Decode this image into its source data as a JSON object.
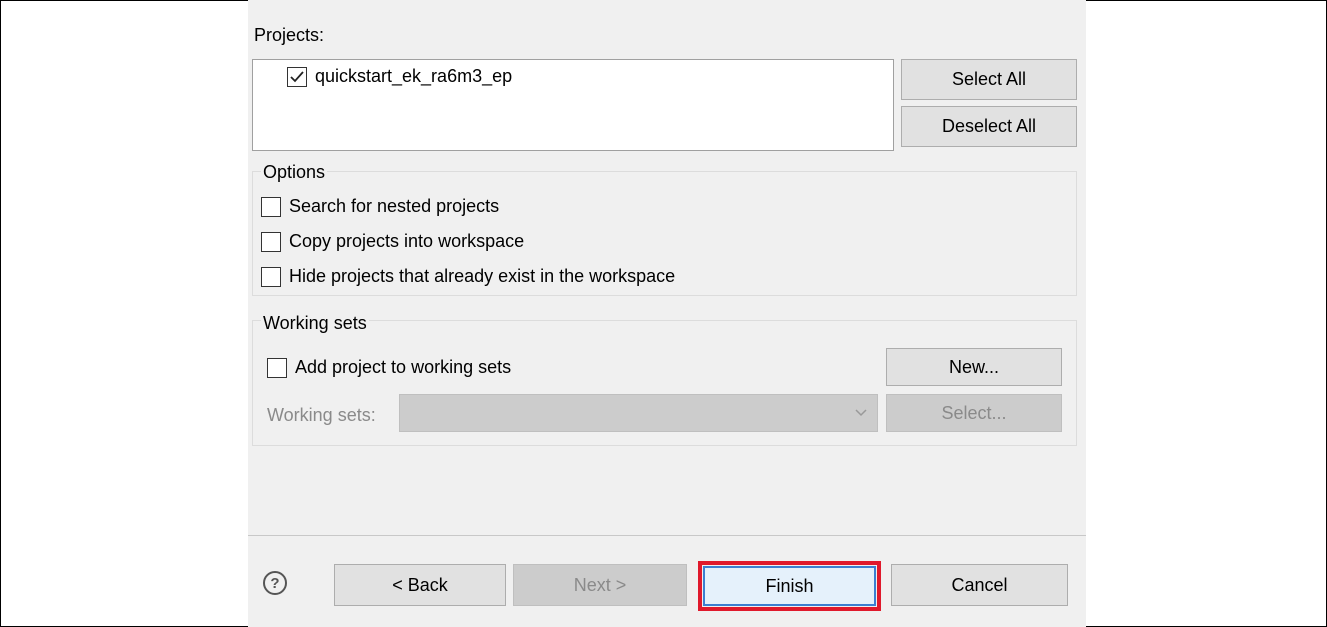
{
  "projects_label": "Projects:",
  "projects": [
    {
      "name": "quickstart_ek_ra6m3_ep",
      "checked": true
    }
  ],
  "select_all_label": "Select All",
  "deselect_all_label": "Deselect All",
  "options": {
    "title": "Options",
    "search_nested": "Search for nested projects",
    "copy_into_workspace": "Copy projects into workspace",
    "hide_existing": "Hide projects that already exist in the workspace"
  },
  "working_sets": {
    "title": "Working sets",
    "add_to_working_sets": "Add project to working sets",
    "new_label": "New...",
    "sets_label": "Working sets:",
    "sets_value": "",
    "select_label": "Select..."
  },
  "footer": {
    "help_icon_glyph": "?",
    "back_label": "< Back",
    "next_label": "Next >",
    "finish_label": "Finish",
    "cancel_label": "Cancel"
  },
  "colors": {
    "highlight": "#e0192b",
    "dialog_bg": "#f0f0f0"
  }
}
